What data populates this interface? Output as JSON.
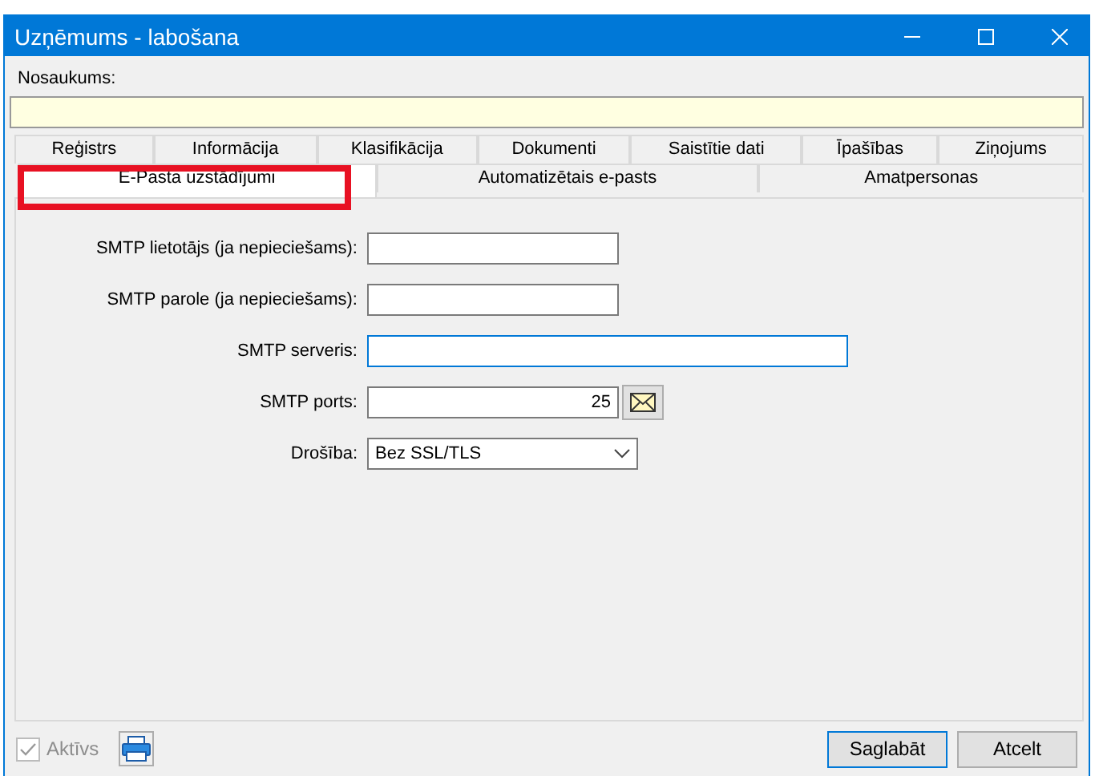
{
  "window": {
    "title": "Uzņēmums - labošana"
  },
  "name_field": {
    "label": "Nosaukums:"
  },
  "tab_rows": [
    [
      {
        "label": "Reģistrs",
        "selected": false,
        "highlighted": false
      },
      {
        "label": "Informācija",
        "selected": false,
        "highlighted": false
      },
      {
        "label": "Klasifikācija",
        "selected": false,
        "highlighted": false
      },
      {
        "label": "Dokumenti",
        "selected": false,
        "highlighted": false
      },
      {
        "label": "Saistītie dati",
        "selected": false,
        "highlighted": false
      },
      {
        "label": "Īpašības",
        "selected": false,
        "highlighted": false
      },
      {
        "label": "Ziņojums",
        "selected": false,
        "highlighted": false
      }
    ],
    [
      {
        "label": "E-Pasta uzstādījumi",
        "selected": true,
        "highlighted": true
      },
      {
        "label": "Automatizētais e-pasts",
        "selected": false,
        "highlighted": false
      },
      {
        "label": "Amatpersonas",
        "selected": false,
        "highlighted": false
      }
    ]
  ],
  "fields": [
    {
      "kind": "text",
      "label": "SMTP lietotājs (ja nepieciešams):",
      "focused": false
    },
    {
      "kind": "text",
      "label": "SMTP parole (ja nepieciešams):",
      "focused": false
    },
    {
      "kind": "wide",
      "label": "SMTP serveris:",
      "focused": true
    },
    {
      "kind": "number",
      "label": "SMTP ports:",
      "value": "25",
      "focused": false
    },
    {
      "kind": "select",
      "label": "Drošība:",
      "value": "Bez SSL/TLS",
      "focused": false
    }
  ],
  "footer": {
    "active": {
      "label": "Aktīvs",
      "checked": true,
      "disabled": true
    },
    "buttons": [
      {
        "label": "Saglabāt",
        "default": true
      },
      {
        "label": "Atcelt",
        "default": false
      }
    ]
  }
}
